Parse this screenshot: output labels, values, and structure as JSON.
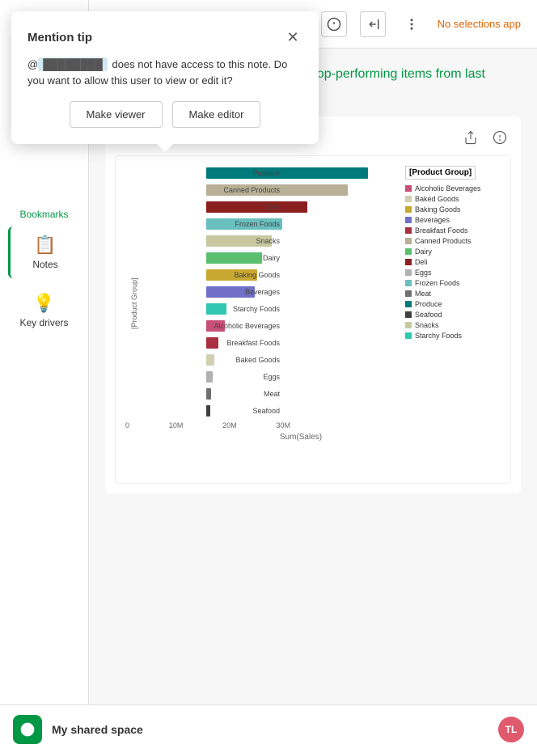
{
  "topbar": {
    "no_selections": "No selections app",
    "icons": [
      "share",
      "stop",
      "users",
      "info",
      "collapse",
      "more"
    ]
  },
  "sidebar": {
    "bookmarks_label": "Bookmarks",
    "notes_label": "Notes",
    "key_drivers_label": "Key drivers",
    "collapse_label": "←"
  },
  "mention_tip": {
    "title": "Mention tip",
    "body_prefix": "@",
    "user_name": "████████",
    "body_suffix": " does not have access to this note. Do you want to allow this user to view or edit it?",
    "btn_viewer": "Make viewer",
    "btn_editor": "Make editor"
  },
  "note": {
    "mention_prefix": "@",
    "mention_name": "███ ██████",
    "text": "Take a look at the top-performing items from last quarter."
  },
  "chart": {
    "y_axis_label": "[Product Group]",
    "x_axis_label": "Sum(Sales)",
    "x_ticks": [
      "0",
      "10M",
      "20M",
      "30M"
    ],
    "bars": [
      {
        "label": "Produce",
        "value": 160,
        "color": "#007a7a"
      },
      {
        "label": "Canned Products",
        "value": 140,
        "color": "#b8b096"
      },
      {
        "label": "Deli",
        "value": 100,
        "color": "#8b2020"
      },
      {
        "label": "Frozen Foods",
        "value": 75,
        "color": "#6abfbf"
      },
      {
        "label": "Snacks",
        "value": 65,
        "color": "#c8c8a0"
      },
      {
        "label": "Dairy",
        "value": 55,
        "color": "#5cbf70"
      },
      {
        "label": "Baking Goods",
        "value": 50,
        "color": "#c8a830"
      },
      {
        "label": "Beverages",
        "value": 48,
        "color": "#7070c8"
      },
      {
        "label": "Starchy Foods",
        "value": 20,
        "color": "#30c8b0"
      },
      {
        "label": "Alcoholic Beverages",
        "value": 18,
        "color": "#c85078"
      },
      {
        "label": "Breakfast Foods",
        "value": 12,
        "color": "#a83040"
      },
      {
        "label": "Baked Goods",
        "value": 8,
        "color": "#d0d0b0"
      },
      {
        "label": "Eggs",
        "value": 6,
        "color": "#b0b0b0"
      },
      {
        "label": "Meat",
        "value": 5,
        "color": "#707070"
      },
      {
        "label": "Seafood",
        "value": 4,
        "color": "#404040"
      }
    ],
    "legend_title": "[Product Group]",
    "legend_items": [
      {
        "label": "Alcoholic Beverages",
        "color": "#c85078"
      },
      {
        "label": "Baked Goods",
        "color": "#d0d0b0"
      },
      {
        "label": "Baking Goods",
        "color": "#c8a830"
      },
      {
        "label": "Beverages",
        "color": "#7070c8"
      },
      {
        "label": "Breakfast Foods",
        "color": "#a83040"
      },
      {
        "label": "Canned Products",
        "color": "#b8b096"
      },
      {
        "label": "Dairy",
        "color": "#5cbf70"
      },
      {
        "label": "Deli",
        "color": "#8b2020"
      },
      {
        "label": "Eggs",
        "color": "#b0b0b0"
      },
      {
        "label": "Frozen Foods",
        "color": "#6abfbf"
      },
      {
        "label": "Meat",
        "color": "#707070"
      },
      {
        "label": "Produce",
        "color": "#007a7a"
      },
      {
        "label": "Seafood",
        "color": "#404040"
      },
      {
        "label": "Snacks",
        "color": "#c8c8a0"
      },
      {
        "label": "Starchy Foods",
        "color": "#30c8b0"
      }
    ]
  },
  "bottom_bar": {
    "space_name": "My shared space",
    "user_initials": "TL"
  }
}
